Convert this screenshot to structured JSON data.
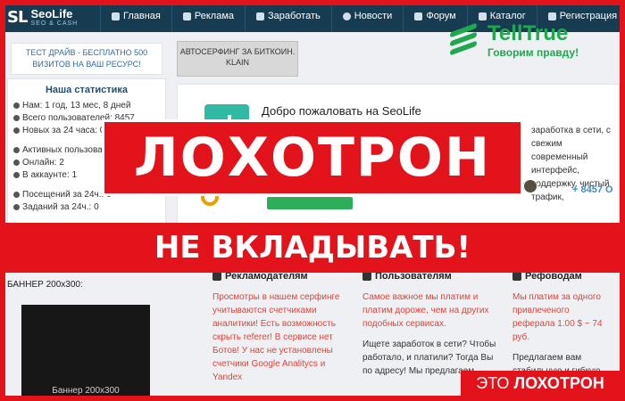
{
  "header": {
    "logo_mark": "SL",
    "logo_name": "SeoLife",
    "logo_tagline": "SEO & CASH",
    "nav": [
      {
        "label": "Главная",
        "icon": "home-icon"
      },
      {
        "label": "Реклама",
        "icon": "megaphone-icon"
      },
      {
        "label": "Заработать",
        "icon": "dollar-icon"
      },
      {
        "label": "Новости",
        "icon": "globe-icon"
      },
      {
        "label": "Форум",
        "icon": "chat-icon"
      },
      {
        "label": "Каталог",
        "icon": "folder-icon"
      },
      {
        "label": "Регистрация",
        "icon": "plus-icon"
      }
    ]
  },
  "watermark": {
    "name": "TellTrue",
    "slogan": "Говорим правду!",
    "color": "#1fa84f"
  },
  "sidebar": {
    "promo": "ТЕСТ ДРАЙВ - БЕСПЛАТНО 500 ВИЗИТОВ НА ВАШ РЕСУРС!",
    "stats_title": "Наша статистика",
    "stats": [
      "Нам: 1 год, 13 мес, 8 дней",
      "Всего пользователей: 8457",
      "Новых за 24 часа: 0"
    ],
    "stats2": [
      "Активных пользователей",
      "Онлайн: 2",
      "В аккаунте: 1"
    ],
    "stats3": [
      "Посещений за 24ч.: 0",
      "Заданий за 24ч.: 0"
    ],
    "banner_title": "БАННЕР 200x300:",
    "banner_label": "Баннер 200x300"
  },
  "main": {
    "surf_button": "АВТОСЕРФИНГ ЗА БИТКОИН. KLAIN",
    "welcome_title": "Добро пожаловать на SeoLife",
    "welcome_desc": "заработка в сети, с свежим современный интерфейс, поддержку, чистый трафик,",
    "users_count": "+ 8457 О",
    "columns": [
      {
        "title": "Рекламодателям",
        "red": "Просмотры в нашем серфинге учитываются счетчиками аналитики! Есть возможность скрыть referer! В сервисе нет Ботов! У нас не установлены счетчики Google Analitycs и Yandex",
        "dark": ""
      },
      {
        "title": "Пользователям",
        "red": "Самое важное мы платим и платим дороже, чем на других подобных сервисах.",
        "dark": "Ищете заработок в сети? Чтобы работало, и платили? Тогда Вы по адресу! Мы предлагаем"
      },
      {
        "title": "Рефоводам",
        "red": "Мы платим за одного привлеченого реферала 1.00 $ ~ 74 руб.",
        "dark": "Предлагаем вам стабильную и гибкую 2-х уровневую реферальную"
      }
    ]
  },
  "overlays": {
    "scam_big": "ЛОХОТРОН",
    "warning": "НЕ ВКЛАДЫВАТЬ!",
    "scam_tag_prefix": "ЭТО",
    "scam_tag_word": "ЛОХОТРОН",
    "accent_color": "#e3131b"
  }
}
